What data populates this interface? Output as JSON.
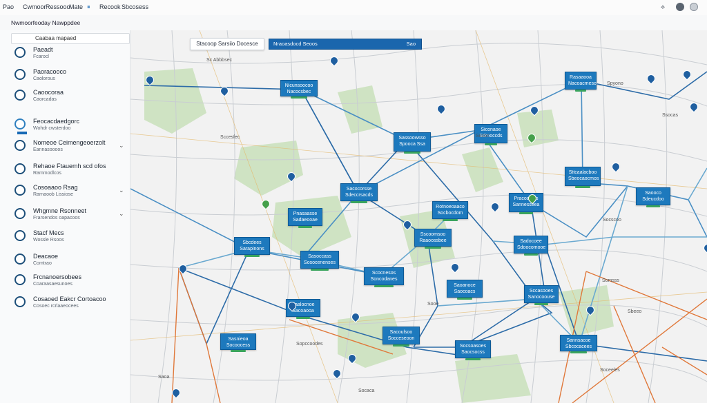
{
  "topbar": {
    "items": [
      "Pao",
      "Cwmoor",
      "Ressooo",
      "Mate",
      "Recook",
      "Sbcosess"
    ],
    "right_icons": [
      "settings-icon",
      "globe-icon",
      "avatar-icon"
    ]
  },
  "subheader": {
    "title": "Nwmoorfeoday Nawppdee"
  },
  "sidebar": {
    "search_text": "Caabaa mapaed",
    "items": [
      {
        "title": "Paeadt",
        "sub": "Fcarocl",
        "icon": "layer-icon",
        "chev": ""
      },
      {
        "title": "Paoracooco",
        "sub": "Caolorous",
        "icon": "cloud-icon",
        "chev": ""
      },
      {
        "title": "Caoocoraa",
        "sub": "Caorcadas",
        "icon": "cloud-icon",
        "chev": ""
      },
      {
        "title": "Feocacdaedgorc",
        "sub": "Wohdr cwsterdoo",
        "icon": "route-icon",
        "chev": ""
      },
      {
        "title": "Nomeoe Ceimengeoerzolt",
        "sub": "Eannasoooos",
        "icon": "target-icon",
        "chev": "⌄"
      },
      {
        "title": "Rehaoe Ftauemh scd ofos",
        "sub": "Rammodlcos",
        "icon": "network-icon",
        "chev": ""
      },
      {
        "title": "Cosoaaoo Rsag",
        "sub": "Rarnaoob Lissiose",
        "icon": "node-icon",
        "chev": "⌄"
      },
      {
        "title": "Whgmne Rsonneet",
        "sub": "Frarsendos oapacoos",
        "icon": "node-icon",
        "chev": "⌄"
      },
      {
        "title": "Stacf Mecs",
        "sub": "Wossle Rsoos",
        "icon": "pin-icon",
        "chev": ""
      },
      {
        "title": "Deacaoe",
        "sub": "Comtrao",
        "icon": "node-icon",
        "chev": ""
      },
      {
        "title": "Frcnanoersobees",
        "sub": "Coaraasaesunoes",
        "icon": "node-icon",
        "chev": ""
      },
      {
        "title": "Cosaoed Eakcr Cortoacoo",
        "sub": "Cosoec rcrlaaeocees",
        "icon": "node-icon",
        "chev": ""
      }
    ]
  },
  "map": {
    "search": "Stacoop  Sarsiio Docesce",
    "info_bar": {
      "left": "Nraoasdocd Seoos",
      "right": "Sao"
    },
    "nodes": [
      {
        "l1": "Nicunsoocoo",
        "l2": "Nacocsbec"
      },
      {
        "l1": "Rasaaooa",
        "l2": "Nacoacmeso"
      },
      {
        "l1": "Sassoowsso",
        "l2": "Spooca  Ssa"
      },
      {
        "l1": "Siconaoe",
        "l2": "Sdrooccds"
      },
      {
        "l1": "Sacocorsse",
        "l2": "Sdeccrsacds"
      },
      {
        "l1": "Sttcaalacboo",
        "l2": "Sbeocaocmos"
      },
      {
        "l1": "Pracoaloos",
        "l2": "Sannesseea"
      },
      {
        "l1": "Pnasaasse",
        "l2": "Sadaeooae"
      },
      {
        "l1": "Saooco",
        "l2": "Sdeucdoo"
      },
      {
        "l1": "Rotnoeoaaco",
        "l2": "Socbocdom"
      },
      {
        "l1": "Sscoomsoo",
        "l2": "Raaoossbee"
      },
      {
        "l1": "Sbcdees",
        "l2": "Sarapinons"
      },
      {
        "l1": "Sadocoee",
        "l2": "Sdoocomooe"
      },
      {
        "l1": "Sasoccass",
        "l2": "Sosocenenses"
      },
      {
        "l1": "Scocnesos",
        "l2": "Soncodanes"
      },
      {
        "l1": "Saoanoce",
        "l2": "Saocoacs"
      },
      {
        "l1": "Sccasooes",
        "l2": "Sanocoouse"
      },
      {
        "l1": "Saalocnoe",
        "l2": "Sacoaooa"
      },
      {
        "l1": "Sasnieoa",
        "l2": "Socoocess"
      },
      {
        "l1": "Sacoulsoo",
        "l2": "Socceseoon"
      },
      {
        "l1": "Socsoasoes",
        "l2": "Saocsocss"
      },
      {
        "l1": "Sannsacoe",
        "l2": "Sbcocacees"
      }
    ],
    "places": [
      "Sc Abbbsec",
      "Sccesfec",
      "Spyono",
      "Socscoo",
      "Somsss",
      "Sooe",
      "Sbeeo",
      "Ssocas",
      "Sopccoodes",
      "Socaca",
      "Soceeles",
      "Sococ",
      "Saoa"
    ]
  }
}
